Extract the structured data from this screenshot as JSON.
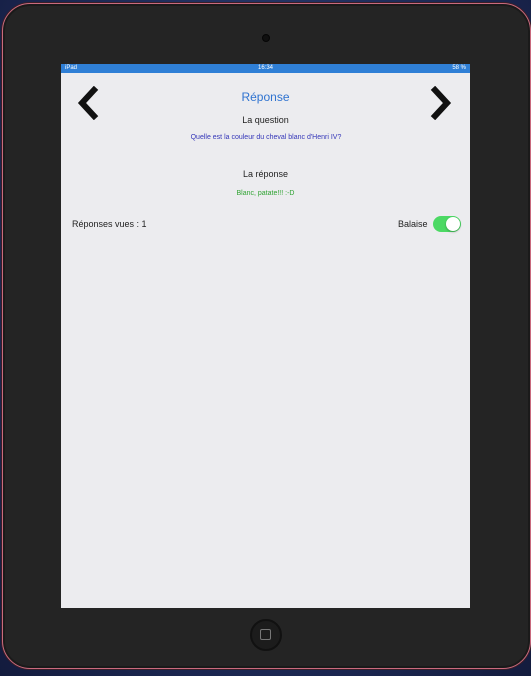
{
  "status_bar": {
    "carrier": "iPad",
    "time": "16:34",
    "battery": "58 %"
  },
  "nav": {
    "title": "Réponse",
    "prev_icon": "chevron-left-icon",
    "next_icon": "chevron-right-icon"
  },
  "question": {
    "label": "La question",
    "text": "Quelle est la couleur du cheval blanc d'Henri IV?"
  },
  "answer": {
    "label": "La réponse",
    "text": "Blanc, patate!!! :-D"
  },
  "footer": {
    "seen_text": "Réponses vues : 1",
    "toggle_label": "Balaise",
    "toggle_on": true
  },
  "colors": {
    "accent": "#2f73d0",
    "question": "#3436b8",
    "answer": "#2fa332",
    "toggle_on": "#4cd964",
    "bezel": "#242424"
  }
}
